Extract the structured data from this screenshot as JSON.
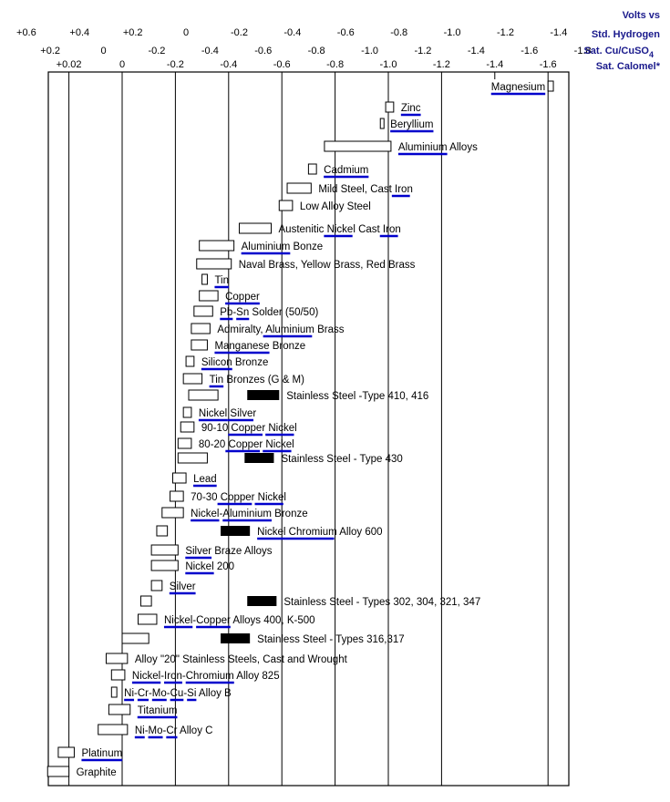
{
  "chart_data": {
    "type": "bar",
    "subtype": "galvanic-series-range",
    "title": "",
    "legend": {
      "heading": "Volts vs",
      "scales": [
        "Std. Hydrogen",
        "Sat. Cu/CuSO4",
        "Sat. Calomel*"
      ]
    },
    "axes": [
      {
        "name": "Std. Hydrogen",
        "ticks": [
          "+0.6",
          "+0.4",
          "+0.2",
          "0",
          "-0.2",
          "-0.4",
          "-0.6",
          "-0.8",
          "-1.0",
          "-1.2",
          "-1.4"
        ],
        "values": [
          0.6,
          0.4,
          0.2,
          0,
          -0.2,
          -0.4,
          -0.6,
          -0.8,
          -1.0,
          -1.2,
          -1.4
        ]
      },
      {
        "name": "Sat. Cu/CuSO4",
        "ticks": [
          "+0.2",
          "0",
          "-0.2",
          "-0.4",
          "-0.6",
          "-0.8",
          "-1.0",
          "-1.2",
          "-1.4",
          "-1.6",
          "-1.8"
        ],
        "values": [
          0.2,
          0,
          -0.2,
          -0.4,
          -0.6,
          -0.8,
          -1.0,
          -1.2,
          -1.4,
          -1.6,
          -1.8
        ]
      },
      {
        "name": "Sat. Calomel*",
        "ticks": [
          "+0.02",
          "0",
          "-0.2",
          "-0.4",
          "-0.6",
          "-0.8",
          "-1.0",
          "-1.2",
          "-1.4",
          "-1.6"
        ],
        "values": [
          0.2,
          0,
          -0.2,
          -0.4,
          -0.6,
          -0.8,
          -1.0,
          -1.2,
          -1.4,
          -1.6
        ]
      }
    ],
    "xlim_calomel": [
      0.28,
      -1.68
    ],
    "gridlines_calomel": [
      0.2,
      0,
      -0.2,
      -0.4,
      -0.6,
      -0.8,
      -1.0,
      -1.2,
      -1.6
    ],
    "units": "Volts vs Sat. Calomel",
    "rows": [
      {
        "label": "Magnesium",
        "range": [
          -1.6,
          -1.62
        ],
        "label_side": "left",
        "links": [
          "Magnesium"
        ]
      },
      {
        "label": "Zinc",
        "range": [
          -0.99,
          -1.02
        ],
        "links": [
          "Zinc"
        ]
      },
      {
        "label": "Beryllium",
        "range": [
          -0.97,
          -0.98
        ],
        "links": [
          "Beryllium"
        ]
      },
      {
        "label": "Aluminium Alloys",
        "range": [
          -0.76,
          -1.01
        ],
        "links": [
          "Aluminium"
        ]
      },
      {
        "label": "Cadmium",
        "range": [
          -0.7,
          -0.73
        ],
        "links": [
          "Cadmium"
        ]
      },
      {
        "label": "Mild Steel, Cast Iron",
        "range": [
          -0.62,
          -0.71
        ],
        "links": [
          "Iron"
        ]
      },
      {
        "label": "Low Alloy Steel",
        "range": [
          -0.59,
          -0.64
        ],
        "links": []
      },
      {
        "label": "Austenitic Nickel Cast Iron",
        "range": [
          -0.44,
          -0.56
        ],
        "links": [
          "Nickel",
          "Iron"
        ]
      },
      {
        "label": "Aluminium Bonze",
        "range": [
          -0.29,
          -0.42
        ],
        "links": [
          "Aluminium"
        ]
      },
      {
        "label": "Naval Brass, Yellow Brass, Red Brass",
        "range": [
          -0.28,
          -0.41
        ],
        "links": []
      },
      {
        "label": "Tin",
        "range": [
          -0.3,
          -0.32
        ],
        "links": [
          "Tin"
        ]
      },
      {
        "label": "Copper",
        "range": [
          -0.29,
          -0.36
        ],
        "links": [
          "Copper"
        ]
      },
      {
        "label": "Pb-Sn Solder (50/50)",
        "range": [
          -0.27,
          -0.34
        ],
        "links": [
          "Pb",
          "Sn"
        ]
      },
      {
        "label": "Admiralty, Aluminium Brass",
        "range": [
          -0.26,
          -0.33
        ],
        "links": [
          "Aluminium"
        ]
      },
      {
        "label": "Manganese Bronze",
        "range": [
          -0.26,
          -0.32
        ],
        "links": [
          "Manganese"
        ]
      },
      {
        "label": "Silicon Bronze",
        "range": [
          -0.24,
          -0.27
        ],
        "links": [
          "Silicon"
        ]
      },
      {
        "label": "Tin Bronzes (G & M)",
        "range": [
          -0.23,
          -0.3
        ],
        "links": [
          "Tin"
        ]
      },
      {
        "label": "Stainless Steel -Type 410, 416",
        "range": [
          -0.25,
          -0.36
        ],
        "active_range": [
          -0.47,
          -0.59
        ],
        "links": []
      },
      {
        "label": "Nickel Silver",
        "range": [
          -0.23,
          -0.26
        ],
        "links": [
          "Nickel",
          "Silver"
        ]
      },
      {
        "label": "90-10 Copper Nickel",
        "range": [
          -0.22,
          -0.27
        ],
        "links": [
          "Copper",
          "Nickel"
        ]
      },
      {
        "label": "80-20 Copper Nickel",
        "range": [
          -0.21,
          -0.26
        ],
        "links": [
          "Copper",
          "Nickel"
        ]
      },
      {
        "label": "Stainless Steel - Type 430",
        "range": [
          -0.21,
          -0.32
        ],
        "active_range": [
          -0.46,
          -0.57
        ],
        "links": []
      },
      {
        "label": "Lead",
        "range": [
          -0.19,
          -0.24
        ],
        "links": [
          "Lead"
        ]
      },
      {
        "label": "70-30 Copper Nickel",
        "range": [
          -0.18,
          -0.23
        ],
        "links": [
          "Copper",
          "Nickel"
        ]
      },
      {
        "label": "Nickel-Aluminium Bronze",
        "range": [
          -0.15,
          -0.23
        ],
        "links": [
          "Nickel",
          "Aluminium"
        ]
      },
      {
        "label": "Nickel Chromium Alloy 600",
        "range": [
          -0.13,
          -0.17
        ],
        "active_range": [
          -0.37,
          -0.48
        ],
        "links": [
          "Nickel",
          "Chromium"
        ]
      },
      {
        "label": "Silver Braze Alloys",
        "range": [
          -0.11,
          -0.21
        ],
        "links": [
          "Silver"
        ]
      },
      {
        "label": "Nickel 200",
        "range": [
          -0.11,
          -0.21
        ],
        "links": [
          "Nickel"
        ]
      },
      {
        "label": "Silver",
        "range": [
          -0.11,
          -0.15
        ],
        "links": [
          "Silver"
        ]
      },
      {
        "label": "Stainless Steel - Types 302, 304, 321, 347",
        "range": [
          -0.07,
          -0.11
        ],
        "active_range": [
          -0.47,
          -0.58
        ],
        "links": []
      },
      {
        "label": "Nickel-Copper Alloys 400, K-500",
        "range": [
          -0.06,
          -0.13
        ],
        "links": [
          "Nickel",
          "Copper"
        ]
      },
      {
        "label": "Stainless Steel - Types 316,317",
        "range": [
          0.0,
          -0.1
        ],
        "active_range": [
          -0.37,
          -0.48
        ],
        "links": []
      },
      {
        "label": "Alloy \"20\" Stainless Steels, Cast and Wrought",
        "range": [
          0.06,
          -0.02
        ],
        "links": []
      },
      {
        "label": "Nickel-Iron-Chromium Alloy 825",
        "range": [
          0.04,
          -0.01
        ],
        "links": [
          "Nickel",
          "Iron",
          "Chromium"
        ]
      },
      {
        "label": "Ni-Cr-Mo-Cu-Si Alloy B",
        "range": [
          0.04,
          0.02
        ],
        "links": [
          "Ni",
          "Cr",
          "Mo",
          "Cu",
          "Si"
        ]
      },
      {
        "label": "Titanium",
        "range": [
          0.05,
          -0.03
        ],
        "links": [
          "Titanium"
        ]
      },
      {
        "label": "Ni-Mo-Cr Alloy C",
        "range": [
          0.09,
          -0.02
        ],
        "links": [
          "Ni",
          "Mo",
          "Cr"
        ]
      },
      {
        "label": "Platinum",
        "range": [
          0.24,
          0.18
        ],
        "links": [
          "Platinum"
        ]
      },
      {
        "label": "Graphite",
        "range": [
          0.28,
          0.2
        ],
        "links": []
      }
    ],
    "colors": {
      "link_underline": "#0000cc",
      "legend": "#1a1a8c",
      "active_bar": "#000000"
    }
  }
}
